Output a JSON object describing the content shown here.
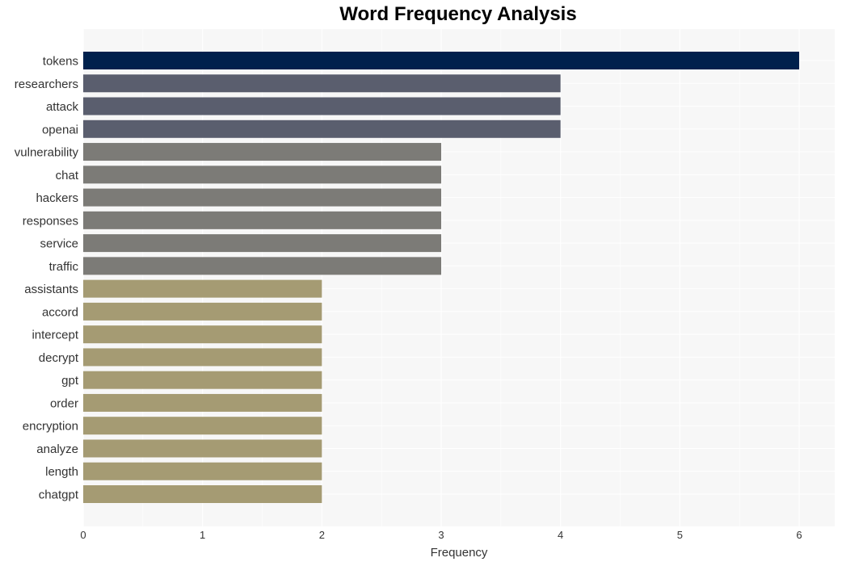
{
  "chart_data": {
    "type": "bar",
    "orientation": "horizontal",
    "title": "Word Frequency Analysis",
    "xlabel": "Frequency",
    "ylabel": "",
    "xlim": [
      0,
      6.3
    ],
    "xticks": [
      0,
      1,
      2,
      3,
      4,
      5,
      6
    ],
    "grid": true,
    "categories": [
      "tokens",
      "researchers",
      "attack",
      "openai",
      "vulnerability",
      "chat",
      "hackers",
      "responses",
      "service",
      "traffic",
      "assistants",
      "accord",
      "intercept",
      "decrypt",
      "gpt",
      "order",
      "encryption",
      "analyze",
      "length",
      "chatgpt"
    ],
    "values": [
      6,
      4,
      4,
      4,
      3,
      3,
      3,
      3,
      3,
      3,
      2,
      2,
      2,
      2,
      2,
      2,
      2,
      2,
      2,
      2
    ],
    "colors": {
      "6": "#00214d",
      "4": "#5a5e6e",
      "3": "#7c7b77",
      "2": "#a59b73"
    },
    "background": "#f7f7f7",
    "gridline_color": "#ffffff"
  }
}
